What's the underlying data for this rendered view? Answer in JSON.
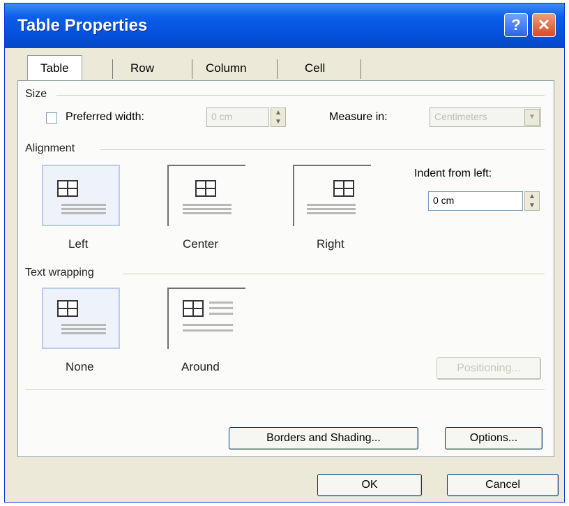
{
  "window": {
    "title": "Table Properties",
    "help_label": "?",
    "close_label": "✕"
  },
  "tabs": [
    {
      "label": "Table",
      "active": true
    },
    {
      "label": "Row"
    },
    {
      "label": "Column"
    },
    {
      "label": "Cell"
    }
  ],
  "size": {
    "section_label": "Size",
    "preferred_width_label": "Preferred width:",
    "preferred_width_value": "0 cm",
    "measure_in_label": "Measure in:",
    "measure_in_value": "Centimeters"
  },
  "alignment": {
    "section_label": "Alignment",
    "options": [
      {
        "label": "Left",
        "selected": true
      },
      {
        "label": "Center"
      },
      {
        "label": "Right"
      }
    ],
    "indent_label": "Indent from left:",
    "indent_value": "0 cm"
  },
  "text_wrapping": {
    "section_label": "Text wrapping",
    "options": [
      {
        "label": "None",
        "selected": true
      },
      {
        "label": "Around"
      }
    ],
    "positioning_label": "Positioning..."
  },
  "buttons": {
    "borders_label": "Borders and Shading...",
    "options_label": "Options...",
    "ok_label": "OK",
    "cancel_label": "Cancel"
  },
  "icons": {
    "spinner_up": "▲",
    "spinner_down": "▼",
    "dropdown": "▼"
  }
}
